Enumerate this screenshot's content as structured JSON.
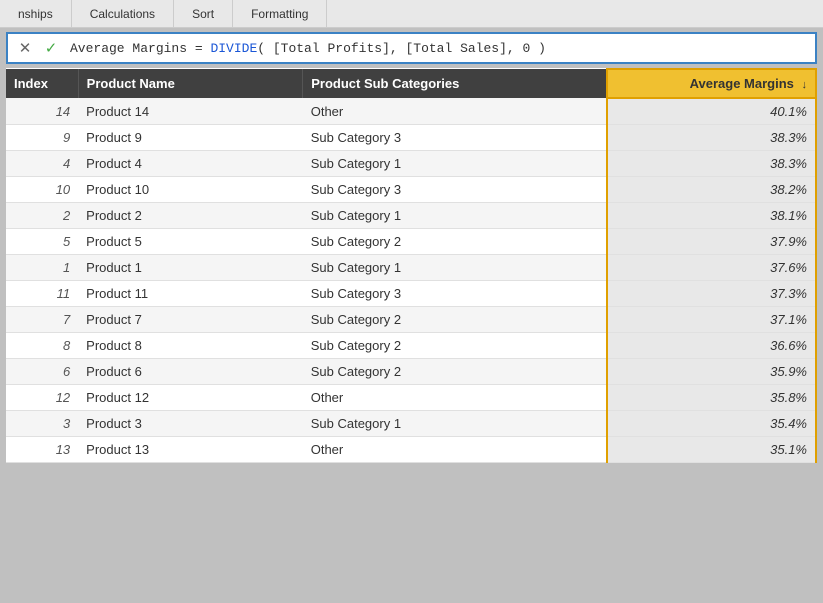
{
  "topbar": {
    "tabs": [
      "nships",
      "Calculations",
      "Sort",
      "Formatting"
    ]
  },
  "formula": {
    "cancel_label": "✕",
    "confirm_label": "✓",
    "text_before": "Average Margins = ",
    "keyword": "DIVIDE",
    "text_after": "( [Total Profits], [Total Sales], 0 )"
  },
  "table": {
    "headers": {
      "index": "Index",
      "product_name": "Product Name",
      "product_sub": "Product Sub Categories",
      "avg_margins": "Average Margins"
    },
    "sort_icon": "↓",
    "rows": [
      {
        "index": "14",
        "name": "Product 14",
        "sub": "Other",
        "margin": "40.1%"
      },
      {
        "index": "9",
        "name": "Product 9",
        "sub": "Sub Category 3",
        "margin": "38.3%"
      },
      {
        "index": "4",
        "name": "Product 4",
        "sub": "Sub Category 1",
        "margin": "38.3%"
      },
      {
        "index": "10",
        "name": "Product 10",
        "sub": "Sub Category 3",
        "margin": "38.2%"
      },
      {
        "index": "2",
        "name": "Product 2",
        "sub": "Sub Category 1",
        "margin": "38.1%"
      },
      {
        "index": "5",
        "name": "Product 5",
        "sub": "Sub Category 2",
        "margin": "37.9%"
      },
      {
        "index": "1",
        "name": "Product 1",
        "sub": "Sub Category 1",
        "margin": "37.6%"
      },
      {
        "index": "11",
        "name": "Product 11",
        "sub": "Sub Category 3",
        "margin": "37.3%"
      },
      {
        "index": "7",
        "name": "Product 7",
        "sub": "Sub Category 2",
        "margin": "37.1%"
      },
      {
        "index": "8",
        "name": "Product 8",
        "sub": "Sub Category 2",
        "margin": "36.6%"
      },
      {
        "index": "6",
        "name": "Product 6",
        "sub": "Sub Category 2",
        "margin": "35.9%"
      },
      {
        "index": "12",
        "name": "Product 12",
        "sub": "Other",
        "margin": "35.8%"
      },
      {
        "index": "3",
        "name": "Product 3",
        "sub": "Sub Category 1",
        "margin": "35.4%"
      },
      {
        "index": "13",
        "name": "Product 13",
        "sub": "Other",
        "margin": "35.1%"
      }
    ]
  }
}
